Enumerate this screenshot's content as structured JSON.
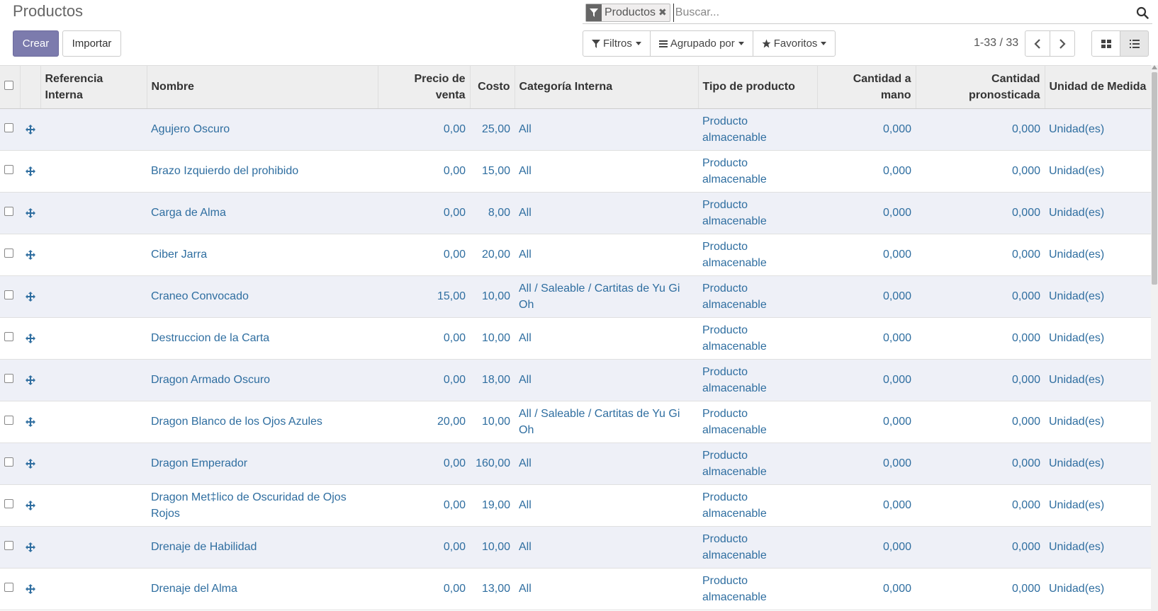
{
  "title": "Productos",
  "buttons": {
    "create": "Crear",
    "import": "Importar"
  },
  "search": {
    "facet_value": "Productos",
    "placeholder": "Buscar..."
  },
  "filters": {
    "filters_label": "Filtros",
    "group_by_label": "Agrupado por",
    "favorites_label": "Favoritos"
  },
  "pager": {
    "value": "1-33 / 33"
  },
  "icons": {
    "facet": "filter-icon",
    "remove": "close-icon",
    "search": "search-icon",
    "prev": "chevron-left-icon",
    "next": "chevron-right-icon",
    "kanban": "kanban-view-icon",
    "list": "list-view-icon",
    "handle": "drag-handle-icon"
  },
  "colors": {
    "primary": "#7c7bad",
    "link": "#2f6ea0",
    "row_alt": "#eef0f7",
    "header_bg": "#eeeeee"
  },
  "columns": {
    "ref": "Referencia Interna",
    "name": "Nombre",
    "sale_price": "Precio de venta",
    "cost": "Costo",
    "category": "Categoría Interna",
    "type": "Tipo de producto",
    "qty_on_hand": "Cantidad a mano",
    "qty_forecast": "Cantidad pronosticada",
    "uom": "Unidad de Medida"
  },
  "rows": [
    {
      "ref": "",
      "name": "Agujero Oscuro",
      "sale_price": "0,00",
      "cost": "25,00",
      "category": "All",
      "type": "Producto almacenable",
      "qty_on_hand": "0,000",
      "qty_forecast": "0,000",
      "uom": "Unidad(es)"
    },
    {
      "ref": "",
      "name": "Brazo Izquierdo del prohibido",
      "sale_price": "0,00",
      "cost": "15,00",
      "category": "All",
      "type": "Producto almacenable",
      "qty_on_hand": "0,000",
      "qty_forecast": "0,000",
      "uom": "Unidad(es)"
    },
    {
      "ref": "",
      "name": "Carga de Alma",
      "sale_price": "0,00",
      "cost": "8,00",
      "category": "All",
      "type": "Producto almacenable",
      "qty_on_hand": "0,000",
      "qty_forecast": "0,000",
      "uom": "Unidad(es)"
    },
    {
      "ref": "",
      "name": "Ciber Jarra",
      "sale_price": "0,00",
      "cost": "20,00",
      "category": "All",
      "type": "Producto almacenable",
      "qty_on_hand": "0,000",
      "qty_forecast": "0,000",
      "uom": "Unidad(es)"
    },
    {
      "ref": "",
      "name": "Craneo Convocado",
      "sale_price": "15,00",
      "cost": "10,00",
      "category": "All / Saleable / Cartitas de Yu Gi Oh",
      "type": "Producto almacenable",
      "qty_on_hand": "0,000",
      "qty_forecast": "0,000",
      "uom": "Unidad(es)"
    },
    {
      "ref": "",
      "name": "Destruccion de la Carta",
      "sale_price": "0,00",
      "cost": "10,00",
      "category": "All",
      "type": "Producto almacenable",
      "qty_on_hand": "0,000",
      "qty_forecast": "0,000",
      "uom": "Unidad(es)"
    },
    {
      "ref": "",
      "name": "Dragon Armado Oscuro",
      "sale_price": "0,00",
      "cost": "18,00",
      "category": "All",
      "type": "Producto almacenable",
      "qty_on_hand": "0,000",
      "qty_forecast": "0,000",
      "uom": "Unidad(es)"
    },
    {
      "ref": "",
      "name": "Dragon Blanco de los Ojos Azules",
      "sale_price": "20,00",
      "cost": "10,00",
      "category": "All / Saleable / Cartitas de Yu Gi Oh",
      "type": "Producto almacenable",
      "qty_on_hand": "0,000",
      "qty_forecast": "0,000",
      "uom": "Unidad(es)"
    },
    {
      "ref": "",
      "name": "Dragon Emperador",
      "sale_price": "0,00",
      "cost": "160,00",
      "category": "All",
      "type": "Producto almacenable",
      "qty_on_hand": "0,000",
      "qty_forecast": "0,000",
      "uom": "Unidad(es)"
    },
    {
      "ref": "",
      "name": "Dragon Met‡lico de Oscuridad de Ojos Rojos",
      "sale_price": "0,00",
      "cost": "19,00",
      "category": "All",
      "type": "Producto almacenable",
      "qty_on_hand": "0,000",
      "qty_forecast": "0,000",
      "uom": "Unidad(es)"
    },
    {
      "ref": "",
      "name": "Drenaje de Habilidad",
      "sale_price": "0,00",
      "cost": "10,00",
      "category": "All",
      "type": "Producto almacenable",
      "qty_on_hand": "0,000",
      "qty_forecast": "0,000",
      "uom": "Unidad(es)"
    },
    {
      "ref": "",
      "name": "Drenaje del Alma",
      "sale_price": "0,00",
      "cost": "13,00",
      "category": "All",
      "type": "Producto almacenable",
      "qty_on_hand": "0,000",
      "qty_forecast": "0,000",
      "uom": "Unidad(es)"
    }
  ]
}
